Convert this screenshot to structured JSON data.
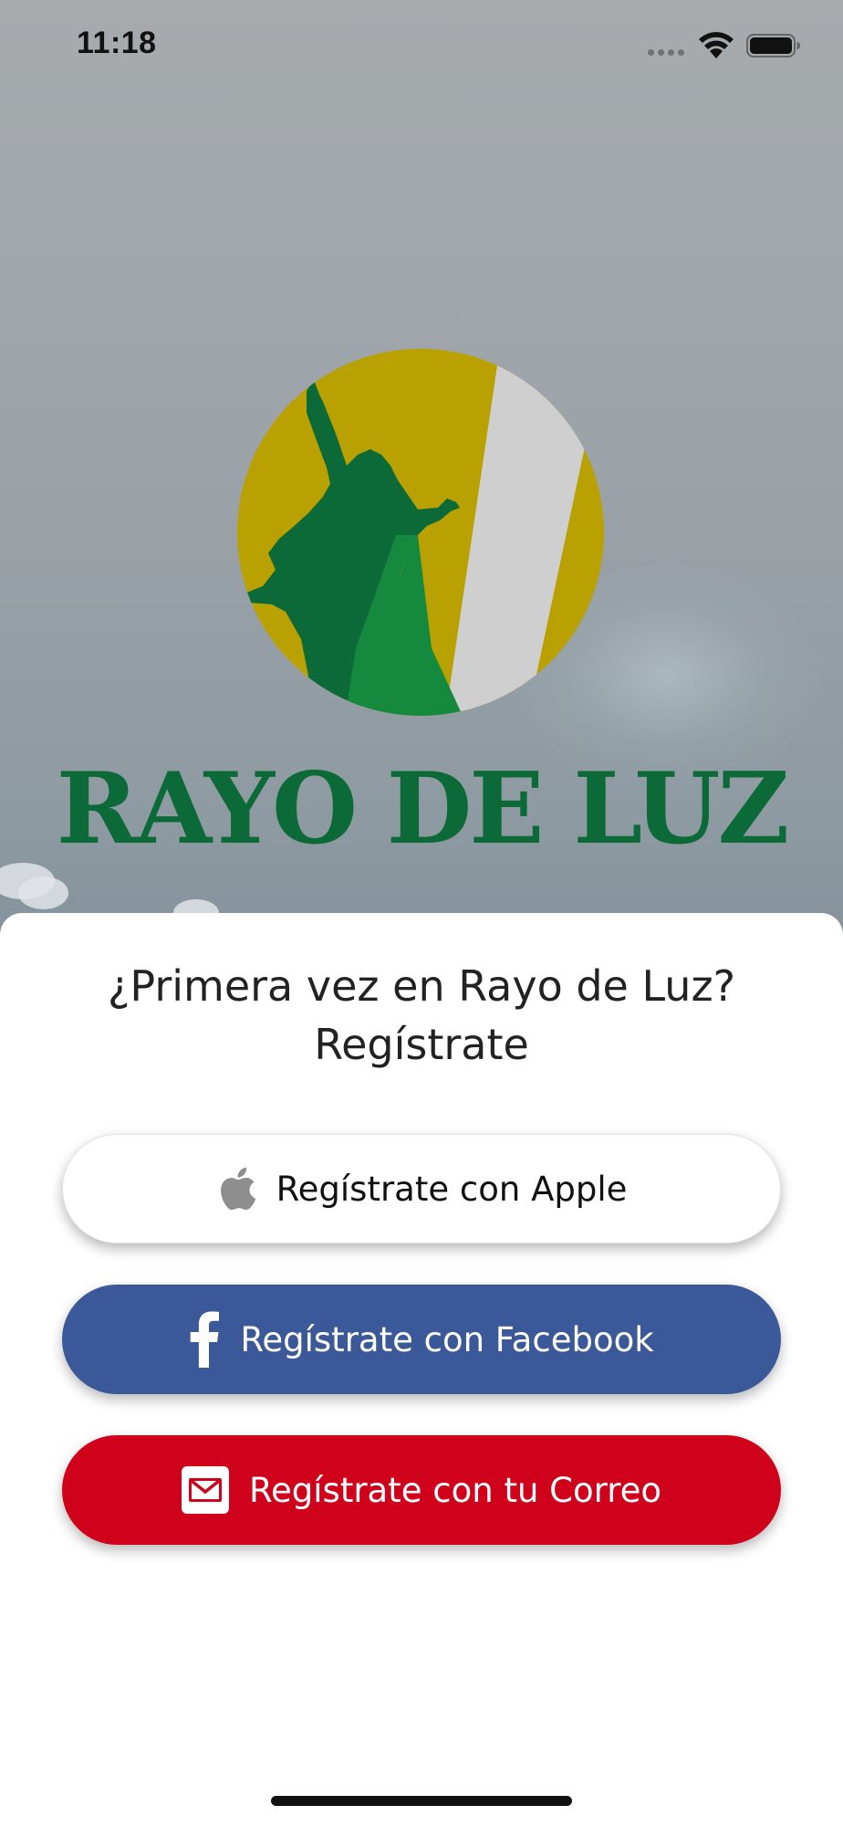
{
  "status_bar": {
    "time": "11:18",
    "icons": [
      "signal-dots-icon",
      "wifi-icon",
      "battery-icon"
    ]
  },
  "logo": {
    "wordmark": "RAYO DE LUZ",
    "colors": {
      "gold": "#b8a100",
      "silver": "#cfcfcf",
      "green_dark": "#0b6a38",
      "green_light": "#15893e"
    }
  },
  "signup": {
    "title_line1": "¿Primera vez en Rayo de Luz?",
    "title_line2": "Regístrate",
    "buttons": {
      "apple": {
        "label": "Regístrate con Apple",
        "icon": "apple-icon",
        "color": "#ffffff"
      },
      "facebook": {
        "label": "Regístrate con Facebook",
        "icon": "facebook-icon",
        "color": "#3b5998"
      },
      "email": {
        "label": "Regístrate con tu Correo",
        "icon": "mail-icon",
        "color": "#d0021b"
      }
    }
  }
}
